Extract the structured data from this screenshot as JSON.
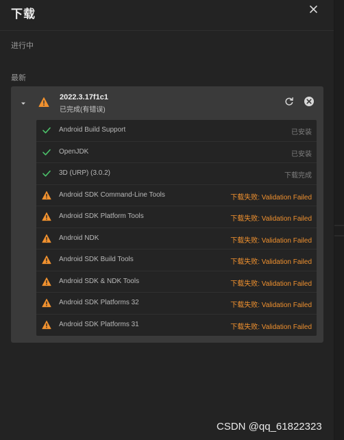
{
  "header": {
    "title": "下载"
  },
  "sections": {
    "in_progress": "进行中",
    "latest": "最新"
  },
  "group": {
    "version": "2022.3.17f1c1",
    "status": "已完成(有错误)"
  },
  "items": [
    {
      "name": "Android Build Support",
      "state": "已安装",
      "result": "ok"
    },
    {
      "name": "OpenJDK",
      "state": "已安装",
      "result": "ok"
    },
    {
      "name": "3D (URP) (3.0.2)",
      "state": "下载完成",
      "result": "ok"
    },
    {
      "name": "Android SDK Command-Line Tools",
      "state": "下载失败: Validation Failed",
      "result": "fail"
    },
    {
      "name": "Android SDK Platform Tools",
      "state": "下载失败: Validation Failed",
      "result": "fail"
    },
    {
      "name": "Android NDK",
      "state": "下载失败: Validation Failed",
      "result": "fail"
    },
    {
      "name": "Android SDK Build Tools",
      "state": "下载失败: Validation Failed",
      "result": "fail"
    },
    {
      "name": "Android SDK & NDK Tools",
      "state": "下载失败: Validation Failed",
      "result": "fail"
    },
    {
      "name": "Android SDK Platforms 32",
      "state": "下载失败: Validation Failed",
      "result": "fail"
    },
    {
      "name": "Android SDK Platforms 31",
      "state": "下载失败: Validation Failed",
      "result": "fail"
    }
  ],
  "watermark": "CSDN @qq_61822323",
  "colors": {
    "success": "#4cc26a",
    "warning": "#f0912f",
    "panel": "#232323",
    "group": "#3a3a3a"
  },
  "icons": {
    "close": "close-icon",
    "expand": "chevron-down-icon",
    "warning": "warning-icon",
    "retry": "refresh-icon",
    "remove": "remove-circle-icon",
    "success": "checkmark-icon"
  }
}
